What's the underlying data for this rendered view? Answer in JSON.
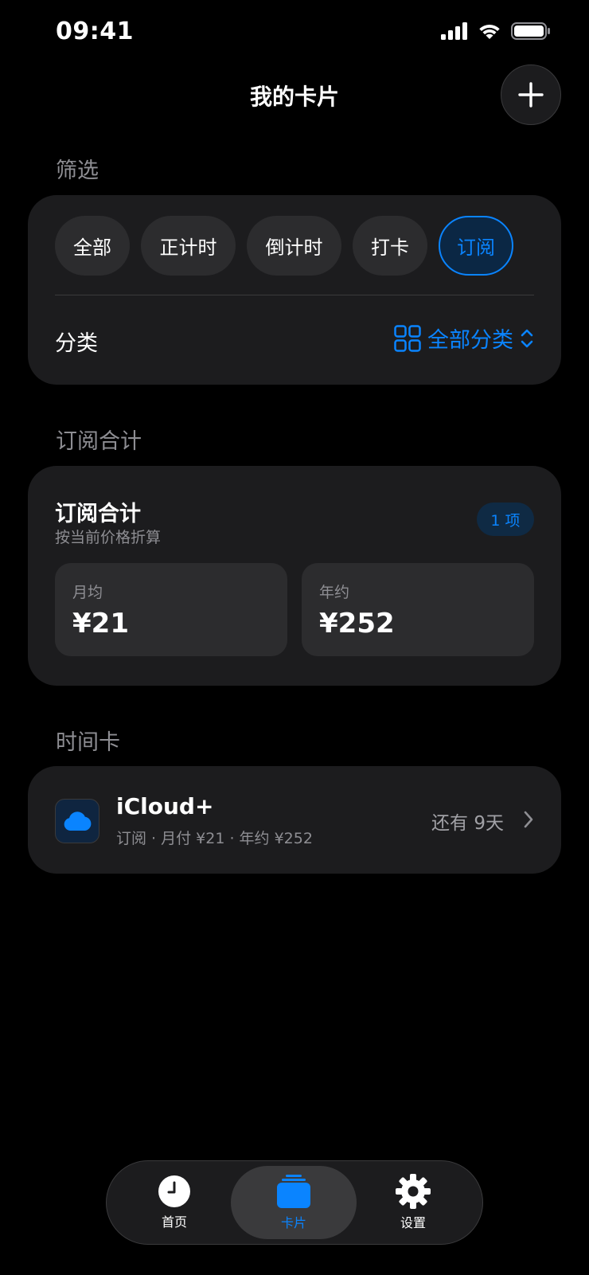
{
  "status_bar": {
    "time": "09:41"
  },
  "header": {
    "title": "我的卡片"
  },
  "filter": {
    "section_label": "筛选",
    "chips": [
      {
        "label": "全部",
        "active": false
      },
      {
        "label": "正计时",
        "active": false
      },
      {
        "label": "倒计时",
        "active": false
      },
      {
        "label": "打卡",
        "active": false
      },
      {
        "label": "订阅",
        "active": true
      }
    ],
    "category_label": "分类",
    "category_value": "全部分类"
  },
  "subscription": {
    "section_label": "订阅合计",
    "title": "订阅合计",
    "subtitle": "按当前价格折算",
    "count_badge": "1 项",
    "monthly_label": "月均",
    "monthly_value": "¥21",
    "yearly_label": "年约",
    "yearly_value": "¥252"
  },
  "time_cards": {
    "section_label": "时间卡",
    "items": [
      {
        "title": "iCloud+",
        "meta": "订阅 · 月付 ¥21 · 年约 ¥252",
        "remaining": "还有 9天",
        "icon": "cloud-icon"
      }
    ]
  },
  "tab_bar": {
    "tabs": [
      {
        "label": "首页",
        "icon": "clock-icon",
        "active": false
      },
      {
        "label": "卡片",
        "icon": "cards-icon",
        "active": true
      },
      {
        "label": "设置",
        "icon": "gear-icon",
        "active": false
      }
    ]
  },
  "colors": {
    "accent": "#0a84ff",
    "card": "#1c1c1e",
    "background": "#000000"
  }
}
